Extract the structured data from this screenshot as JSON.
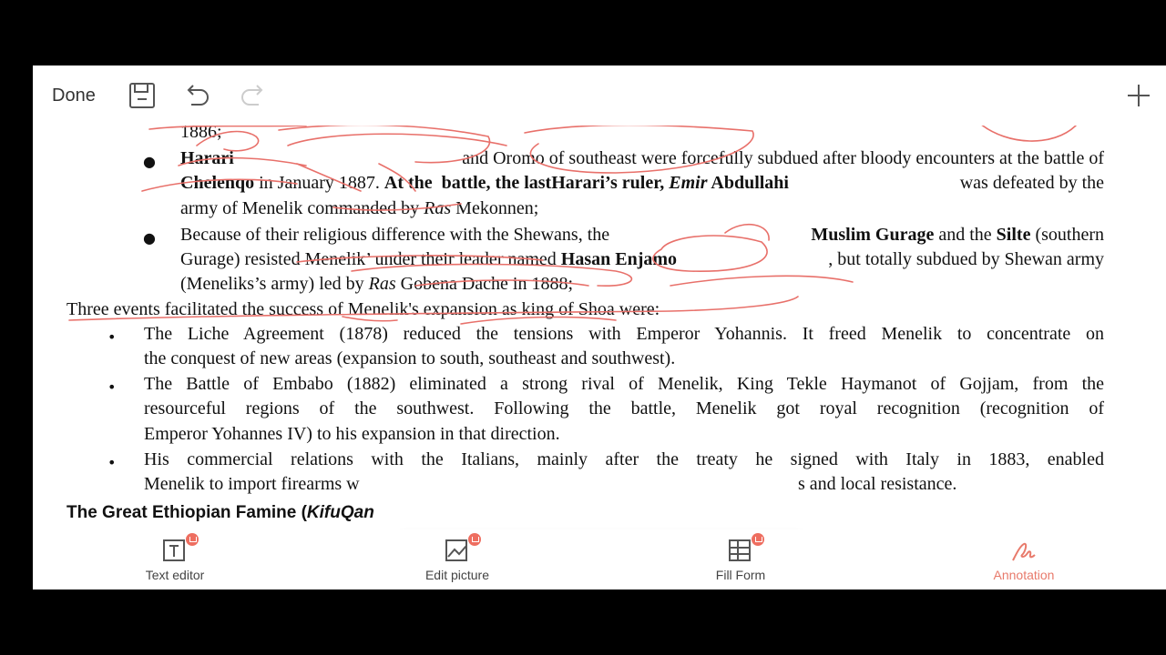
{
  "topbar": {
    "done_label": "Done"
  },
  "document": {
    "l0": "1886;",
    "l1_a": "Harari",
    "l1_b": " and Oromo of southeast were forcefully subdued after bloody encounters at the battle of",
    "l2_a": "Chelenqo",
    "l2_b": " in January 1887.",
    "l2_c": "At the  battle, the lastHarari’s ruler, ",
    "l2_d": "Emir",
    "l2_e": " Abdullahi",
    "l2_f": " was defeated by the",
    "l3_a": "army of Menelik commanded by ",
    "l3_b": "Ras",
    "l3_c": " Mekonnen;",
    "l4_a": "Because of their religious difference with the Shewans, the ",
    "l4_b": "Muslim Gurage",
    "l4_c": " and the ",
    "l4_d": "Silte",
    "l4_e": " (southern",
    "l5_a": "Gurage) resisted Menelik’ under their leader named ",
    "l5_b": "Hasan Enjamo",
    "l5_c": ", but totally subdued by Shewan army",
    "l6_a": "(Meneliks’s army) led by ",
    "l6_b": "Ras",
    "l6_c": " Gobena Dache in 1888;",
    "l7": "Three events facilitated the success of Menelik's expansion as king of Shoa were:",
    "l8": "The Liche Agreement (1878) reduced the tensions with Emperor Yohannis. It freed Menelik to concentrate on",
    "l9": "the conquest of new areas (expansion to south, southeast and southwest).",
    "l10": "The Battle of Embabo (1882) eliminated a strong rival of Menelik, King Tekle Haymanot of Gojjam, from the",
    "l11": "resourceful regions of the southwest. Following the battle, Menelik got royal recognition (recognition of",
    "l12": "Emperor Yohannes IV) to his expansion in that direction.",
    "l13": "His commercial relations with the Italians, mainly after the treaty he signed with Italy in 1883, enabled",
    "l14_a": "Menelik to import firearms w",
    "l14_b": "s and local resistance.",
    "heading_a": "The Great Ethiopian Famine (",
    "heading_b": "KifuQan"
  },
  "bottombar": {
    "text_editor": "Text editor",
    "edit_picture": "Edit picture",
    "fill_form": "Fill Form",
    "annotation": "Annotation"
  },
  "colors": {
    "ink": "#e8706a",
    "accent": "#e87a6b",
    "highlighter": "#f3e600",
    "pen_dot": "#ee3d3d"
  }
}
